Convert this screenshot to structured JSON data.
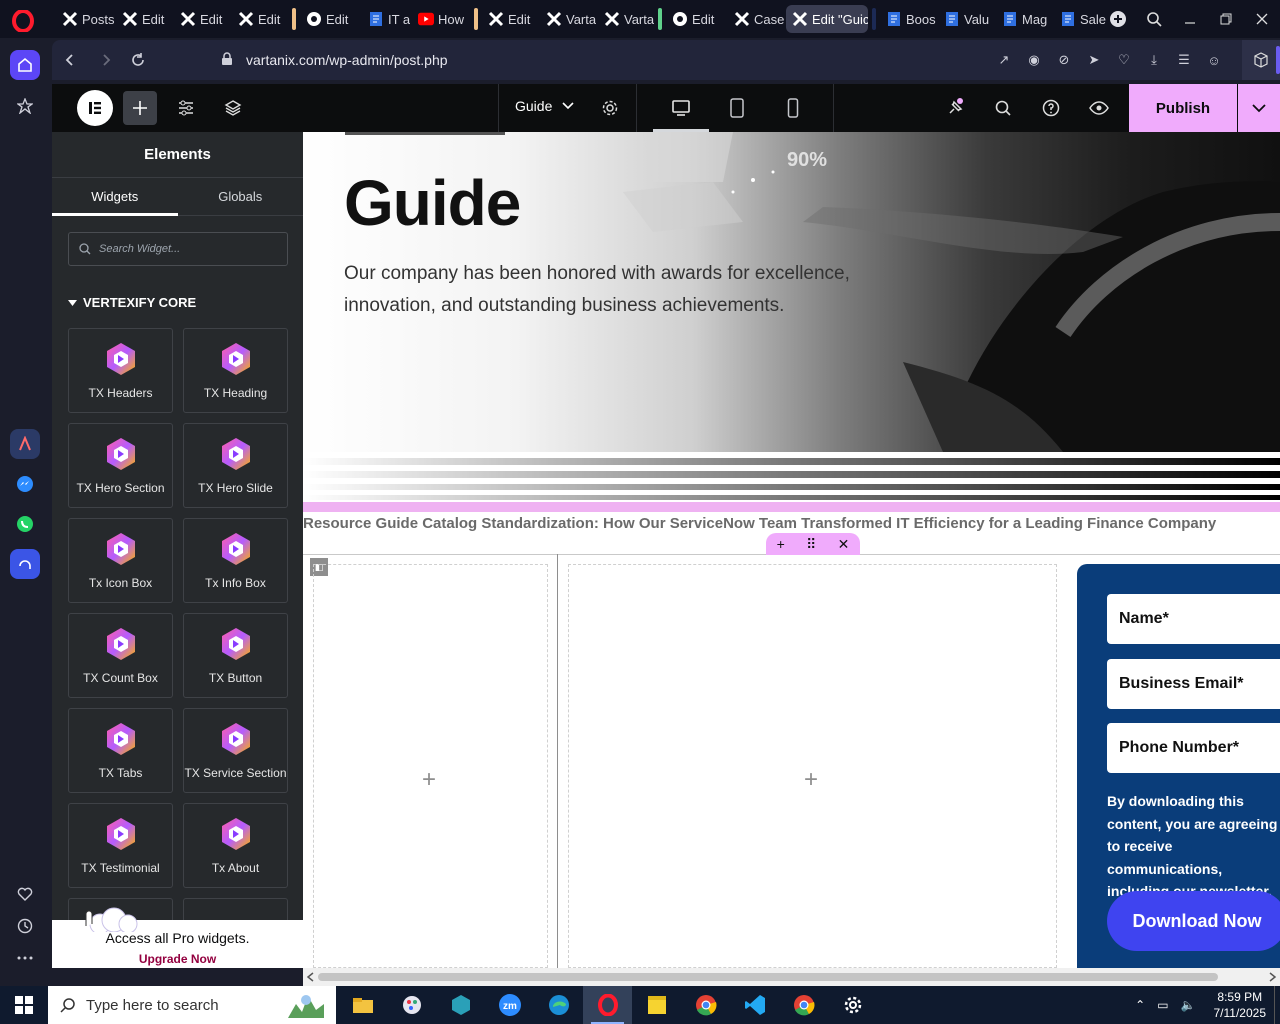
{
  "browser": {
    "tabs": [
      {
        "label": "Posts",
        "icon": "x-logo-icon"
      },
      {
        "label": "Edit",
        "icon": "x-logo-icon"
      },
      {
        "label": "Edit",
        "icon": "x-logo-icon"
      },
      {
        "label": "Edit",
        "icon": "x-logo-icon"
      },
      {
        "label": "Edit",
        "icon": "globe-icon"
      },
      {
        "label": "IT an",
        "icon": "doc-icon"
      },
      {
        "label": "How",
        "icon": "youtube-icon"
      },
      {
        "label": "Edit",
        "icon": "x-logo-icon"
      },
      {
        "label": "Varta",
        "icon": "x-logo-icon"
      },
      {
        "label": "Varta",
        "icon": "x-logo-icon"
      },
      {
        "label": "Edit",
        "icon": "globe-icon"
      },
      {
        "label": "Case",
        "icon": "x-logo-icon"
      },
      {
        "label": "Edit \"Guic",
        "icon": "x-logo-icon",
        "active": true
      },
      {
        "label": "Boos",
        "icon": "doc-icon"
      },
      {
        "label": "Valu",
        "icon": "doc-icon"
      },
      {
        "label": "Mag",
        "icon": "doc-icon"
      },
      {
        "label": "Sales",
        "icon": "doc-icon"
      }
    ],
    "url": "vartanix.com/wp-admin/post.php"
  },
  "editor": {
    "page_name": "Guide",
    "publish_label": "Publish"
  },
  "panel": {
    "title": "Elements",
    "tabs": [
      "Widgets",
      "Globals"
    ],
    "search_placeholder": "Search Widget...",
    "category": "VERTEXIFY CORE",
    "widgets": [
      "TX Headers",
      "TX Heading",
      "TX Hero Section",
      "TX Hero Slide",
      "Tx Icon Box",
      "Tx Info Box",
      "TX Count Box",
      "TX Button",
      "TX Tabs",
      "TX Service Section",
      "TX Testimonial",
      "Tx About"
    ],
    "pro_text": "Access all Pro widgets.",
    "pro_link": "Upgrade Now"
  },
  "canvas": {
    "hero_title": "Guide",
    "hero_subtitle": "Our company has been honored with awards for excellence, innovation, and outstanding business achievements.",
    "hero_badge": "90%",
    "marquee": "Resource Guide Catalog Standardization: How Our ServiceNow Team Transformed IT Efficiency for a Leading Finance Company",
    "form": {
      "name_placeholder": "Name*",
      "email_placeholder": "Business Email*",
      "phone_placeholder": "Phone Number*",
      "note": "By downloading this content, you are agreeing to receive communications, including our newsletter.",
      "button": "Download Now"
    }
  },
  "taskbar": {
    "search_placeholder": "Type here to search",
    "time": "8:59 PM",
    "date": "7/11/2025"
  },
  "colors": {
    "publish": "#f0abfc",
    "form_bg": "#0a3d7a",
    "download_btn": "#3f44f0",
    "opera_red": "#ff1b2d"
  }
}
